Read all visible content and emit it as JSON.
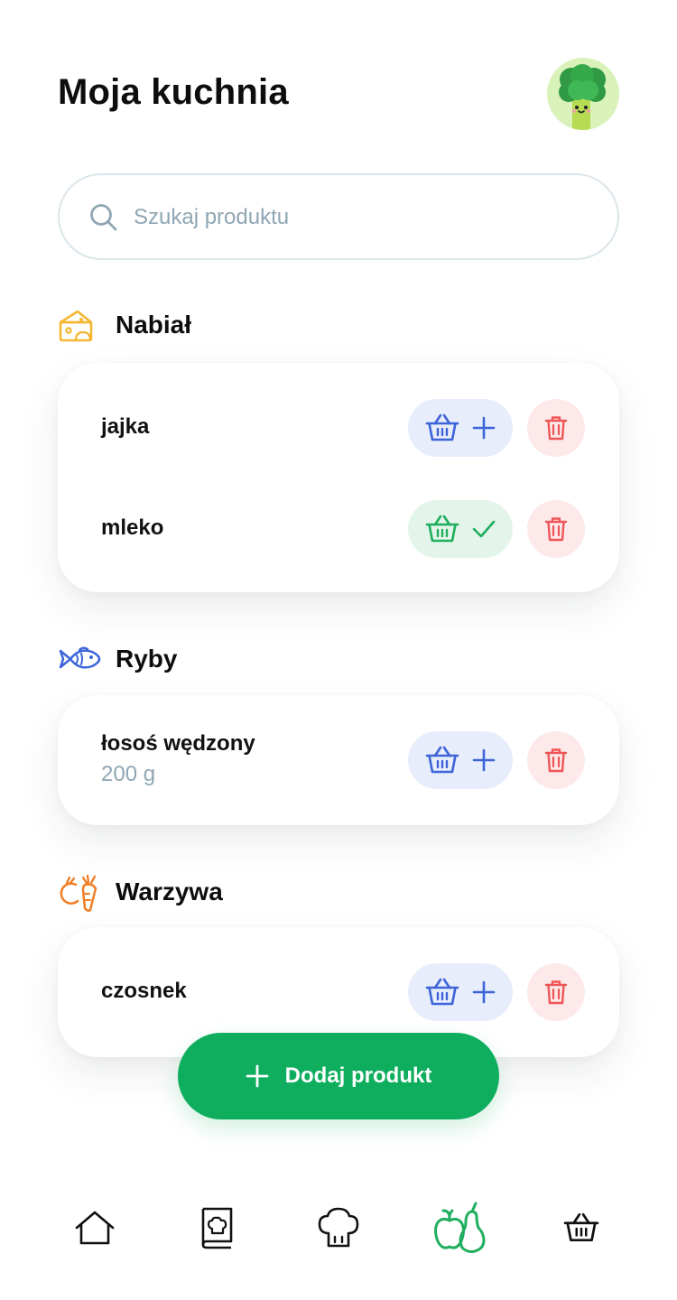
{
  "header": {
    "title": "Moja kuchnia",
    "avatar_icon": "broccoli-avatar"
  },
  "search": {
    "placeholder": "Szukaj produktu",
    "value": "",
    "icon": "search-icon"
  },
  "categories": [
    {
      "title": "Nabiał",
      "icon": "cheese-icon",
      "icon_color": "#f5b731",
      "items": [
        {
          "name": "jajka",
          "quantity": "",
          "in_basket": false
        },
        {
          "name": "mleko",
          "quantity": "",
          "in_basket": true
        }
      ]
    },
    {
      "title": "Ryby",
      "icon": "fish-icon",
      "icon_color": "#3d64d9",
      "items": [
        {
          "name": "łosoś wędzony",
          "quantity": "200 g",
          "in_basket": false
        }
      ]
    },
    {
      "title": "Warzywa",
      "icon": "vegetables-icon",
      "icon_color": "#f07d25",
      "items": [
        {
          "name": "czosnek",
          "quantity": "",
          "in_basket": false
        }
      ]
    }
  ],
  "add_button": {
    "label": "Dodaj produkt",
    "icon": "plus-icon"
  },
  "nav": [
    {
      "id": "home",
      "icon": "home-icon",
      "active": false
    },
    {
      "id": "recipes",
      "icon": "recipe-book-icon",
      "active": false
    },
    {
      "id": "cooking",
      "icon": "chef-hat-icon",
      "active": false
    },
    {
      "id": "pantry",
      "icon": "fruits-icon",
      "active": true
    },
    {
      "id": "shopping",
      "icon": "basket-icon",
      "active": false
    }
  ],
  "colors": {
    "accent_green": "#0fae5e",
    "basket_blue": "#3d64d9",
    "basket_blue_bg": "#e7edfb",
    "basket_green": "#1fae5d",
    "basket_green_bg": "#e3f5ea",
    "trash_red": "#ee5557",
    "trash_bg": "#fde9ea",
    "muted_text": "#8fa6b3"
  }
}
